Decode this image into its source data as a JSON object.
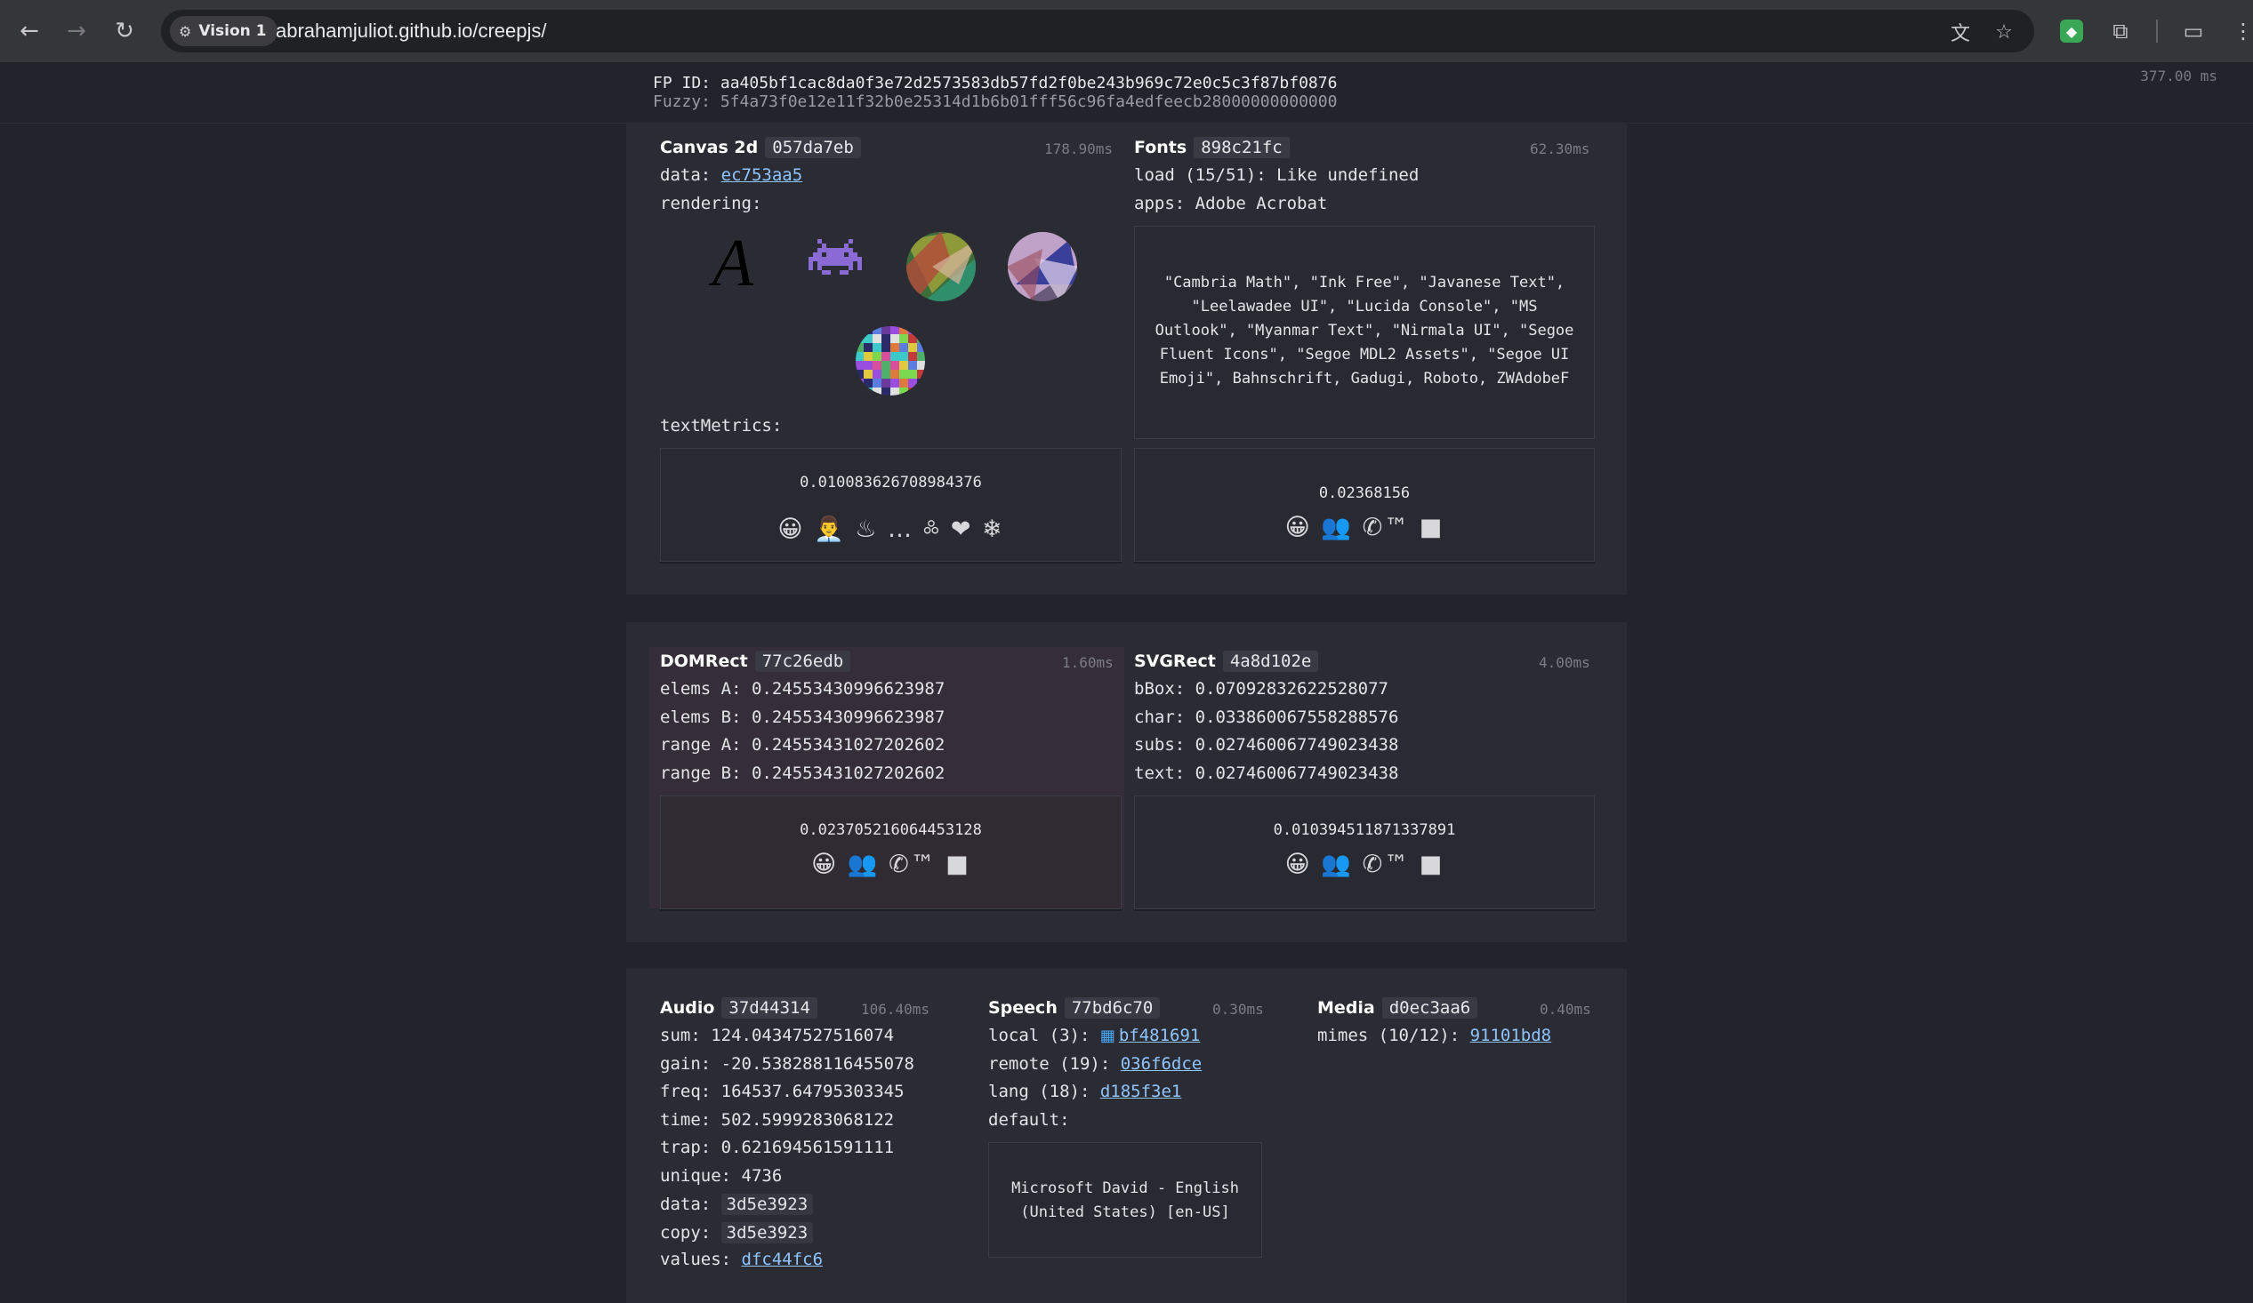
{
  "browser": {
    "site_chip": "Vision 1",
    "url": "abrahamjuliot.github.io/creepjs/"
  },
  "header": {
    "fp_id": "FP ID: aa405bf1cac8da0f3e72d2573583db57fd2f0be243b969c72e0c5c3f87bf0876",
    "fuzzy": "Fuzzy: 5f4a73f0e12e11f32b0e25314d1b6b01fff56c96fa4edfeecb28000000000000",
    "total_time": "377.00 ms"
  },
  "canvas": {
    "title": "Canvas 2d",
    "hash": "057da7eb",
    "time": "178.90ms",
    "data_label": "data:",
    "data_link": "ec753aa5",
    "rendering_label": "rendering:",
    "glyph_a": "A",
    "text_metrics_label": "textMetrics:",
    "metric_value": "0.010083626708984376",
    "metric_glyphs": "😀 👨‍💼 ♨ … ༜ ❤ ❄"
  },
  "fonts": {
    "title": "Fonts",
    "hash": "898c21fc",
    "time": "62.30ms",
    "load": "load (15/51): Like undefined",
    "apps": "apps: Adobe Acrobat",
    "list": "\"Cambria Math\", \"Ink Free\", \"Javanese Text\", \"Leelawadee UI\", \"Lucida Console\", \"MS Outlook\", \"Myanmar Text\", \"Nirmala UI\", \"Segoe Fluent Icons\", \"Segoe MDL2 Assets\", \"Segoe UI Emoji\", Bahnschrift, Gadugi, Roboto, ZWAdobeF",
    "metric_value": "0.02368156",
    "metric_glyphs": "😀 👥 ✆™ ■"
  },
  "domrect": {
    "title": "DOMRect",
    "hash": "77c26edb",
    "time": "1.60ms",
    "rows": [
      "elems A: 0.24553430996623987",
      "elems B: 0.24553430996623987",
      "range A: 0.24553431027202602",
      "range B: 0.24553431027202602"
    ],
    "metric_value": "0.023705216064453128",
    "metric_glyphs": "😀 👥 ✆™ ■"
  },
  "svgrect": {
    "title": "SVGRect",
    "hash": "4a8d102e",
    "time": "4.00ms",
    "rows": [
      "bBox: 0.07092832622528077",
      "char: 0.033860067558288576",
      "subs: 0.027460067749023438",
      "text: 0.027460067749023438"
    ],
    "metric_value": "0.010394511871337891",
    "metric_glyphs": "😀 👥 ✆™ ■"
  },
  "audio": {
    "title": "Audio",
    "hash": "37d44314",
    "time": "106.40ms",
    "rows": [
      "sum: 124.04347527516074",
      "gain: -20.538288116455078",
      "freq: 164537.64795303345",
      "time: 502.5999283068122",
      "trap: 0.621694561591111",
      "unique: 4736"
    ],
    "data_label": "data:",
    "data_value": "3d5e3923",
    "copy_label": "copy:",
    "copy_value": "3d5e3923",
    "values_label": "values:",
    "values_link": "dfc44fc6"
  },
  "speech": {
    "title": "Speech",
    "hash": "77bd6c70",
    "time": "0.30ms",
    "local_label": "local (3):",
    "local_link": "bf481691",
    "remote_label": "remote (19):",
    "remote_link": "036f6dce",
    "lang_label": "lang (18):",
    "lang_link": "d185f3e1",
    "default_label": "default:",
    "default_voice": "Microsoft David - English (United States) [en-US]"
  },
  "media": {
    "title": "Media",
    "hash": "d0ec3aa6",
    "time": "0.40ms",
    "mimes_label": "mimes (10/12):",
    "mimes_link": "91101bd8"
  }
}
